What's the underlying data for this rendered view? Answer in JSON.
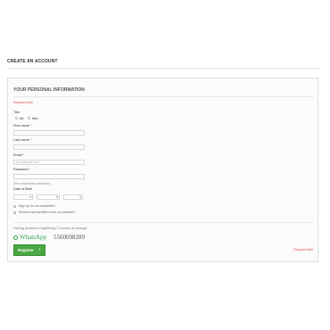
{
  "page_title": "CREATE AN ACCOUNT",
  "form": {
    "title": "YOUR PERSONAL INFORMATION",
    "required_note": "Required field",
    "title_label": "Title",
    "title_options": [
      "Mr.",
      "Mrs."
    ],
    "first_name_label": "First name",
    "last_name_label": "Last name",
    "email_label": "Email",
    "email_placeholder": "your@email.com",
    "password_label": "Password",
    "password_hint": "(Five characters minimum)",
    "dob_label": "Date of Birth",
    "dob_selects": [
      "-",
      "-",
      "-"
    ],
    "newsletter_label": "Sign up for our newsletter!",
    "offers_label": "Receive special offers from our partners!",
    "required_star": "*"
  },
  "help": {
    "text": "Having problems registering? Contact us through",
    "whatsapp_brand": "WhatsApp",
    "whatsapp_number": "5560698289"
  },
  "register_button": {
    "label": "Register",
    "chevron": "›"
  },
  "colors": {
    "accent_green": "#4aa744",
    "required_red": "#e24a4a",
    "whatsapp_green": "#2c9e4a"
  }
}
